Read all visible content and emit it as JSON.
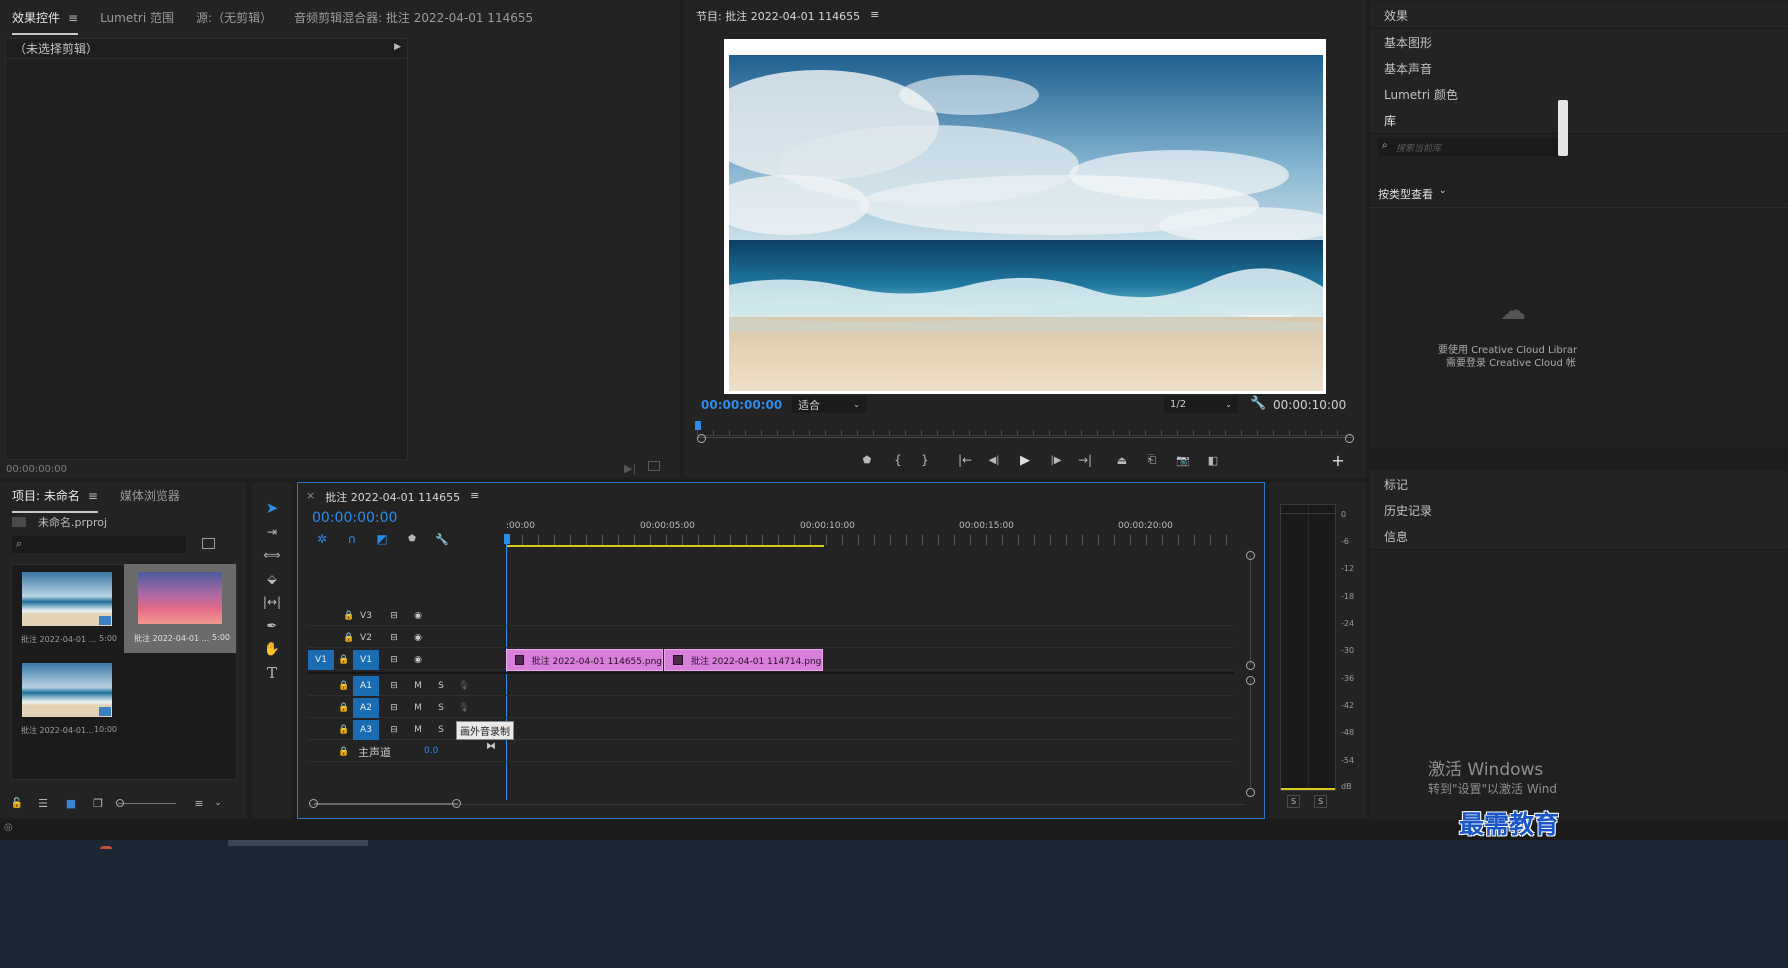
{
  "effect_panel": {
    "tabs": [
      "效果控件",
      "Lumetri 范围",
      "源:（无剪辑）",
      "音频剪辑混合器: 批注 2022-04-01 114655"
    ],
    "no_clip_label": "（未选择剪辑）",
    "timecode": "00:00:00:00"
  },
  "program_monitor": {
    "title": "节目: 批注 2022-04-01 114655",
    "current_time": "00:00:00:00",
    "fit_select": "适合",
    "resolution_select": "1/2",
    "duration": "00:00:10:00"
  },
  "project_panel": {
    "tabs": [
      "项目: 未命名",
      "媒体浏览器"
    ],
    "project_file": "未命名.prproj",
    "search_placeholder": "",
    "items": [
      {
        "name": "批注 2022-04-01 ...",
        "duration": "5:00"
      },
      {
        "name": "批注 2022-04-01 ...",
        "duration": "5:00"
      },
      {
        "name": "批注 2022-04-01...",
        "duration": "10:00"
      }
    ]
  },
  "timeline": {
    "title": "批注 2022-04-01 114655",
    "timecode": "00:00:00:00",
    "ruler": [
      ":00:00",
      "00:00:05:00",
      "00:00:10:00",
      "00:00:15:00",
      "00:00:20:00"
    ],
    "video_tracks": [
      {
        "source": "",
        "label": "V3"
      },
      {
        "source": "",
        "label": "V2"
      },
      {
        "source": "V1",
        "label": "V1"
      }
    ],
    "audio_tracks": [
      {
        "label": "A1",
        "m": "M",
        "s": "S"
      },
      {
        "label": "A2",
        "m": "M",
        "s": "S"
      },
      {
        "label": "A3",
        "m": "M",
        "s": "S"
      }
    ],
    "master_label": "主声道",
    "master_value": "0.0",
    "tooltip": "画外音录制",
    "clips": [
      {
        "label": "批注 2022-04-01 114655.png"
      },
      {
        "label": "批注 2022-04-01 114714.png"
      }
    ]
  },
  "audio_meter": {
    "scale": [
      "0",
      "-6",
      "-12",
      "-18",
      "-24",
      "-30",
      "-36",
      "-42",
      "-48",
      "-54",
      "dB"
    ],
    "solo": [
      "S",
      "S"
    ]
  },
  "right_panel": {
    "items": [
      "效果",
      "基本图形",
      "基本声音",
      "Lumetri 颜色",
      "库"
    ],
    "search_placeholder": "搜索当前库",
    "view_by": "按类型查看",
    "cc_message_1": "要使用 Creative Cloud Librar",
    "cc_message_2": "需要登录 Creative Cloud 帐",
    "bottom_items": [
      "标记",
      "历史记录",
      "信息"
    ]
  },
  "watermark": {
    "activate_title": "激活 Windows",
    "activate_sub": "转到\"设置\"以激活 Wind",
    "brand": "最需教育"
  },
  "colors": {
    "accent": "#2d8ceb",
    "clip": "#d77fd9",
    "selected_track": "#1a6cb3",
    "work_area": "#d8c71d"
  }
}
